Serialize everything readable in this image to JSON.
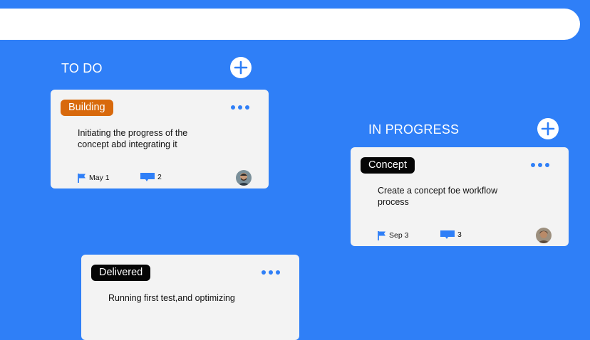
{
  "colors": {
    "background": "#2f7ff7",
    "accent": "#2f7ff7",
    "card": "#f3f3f3",
    "tag_building": "#d8690c",
    "tag_dark": "#050505"
  },
  "columns": [
    {
      "title": "TO DO",
      "add_icon": "plus-circle-icon",
      "cards": [
        {
          "tag": "Building",
          "description": "Initiating the progress of the concept abd integrating it",
          "date": "May 1",
          "comments": "2",
          "more_icon": "more-horizontal-icon",
          "flag_icon": "flag-icon",
          "comment_icon": "comment-icon"
        },
        {
          "tag": "Delivered",
          "description": "Running first test,and optimizing",
          "more_icon": "more-horizontal-icon"
        }
      ]
    },
    {
      "title": "IN PROGRESS",
      "add_icon": "plus-circle-icon",
      "cards": [
        {
          "tag": "Concept",
          "description": "Create a concept foe workflow process",
          "date": "Sep 3",
          "comments": "3",
          "more_icon": "more-horizontal-icon",
          "flag_icon": "flag-icon",
          "comment_icon": "comment-icon"
        }
      ]
    }
  ]
}
